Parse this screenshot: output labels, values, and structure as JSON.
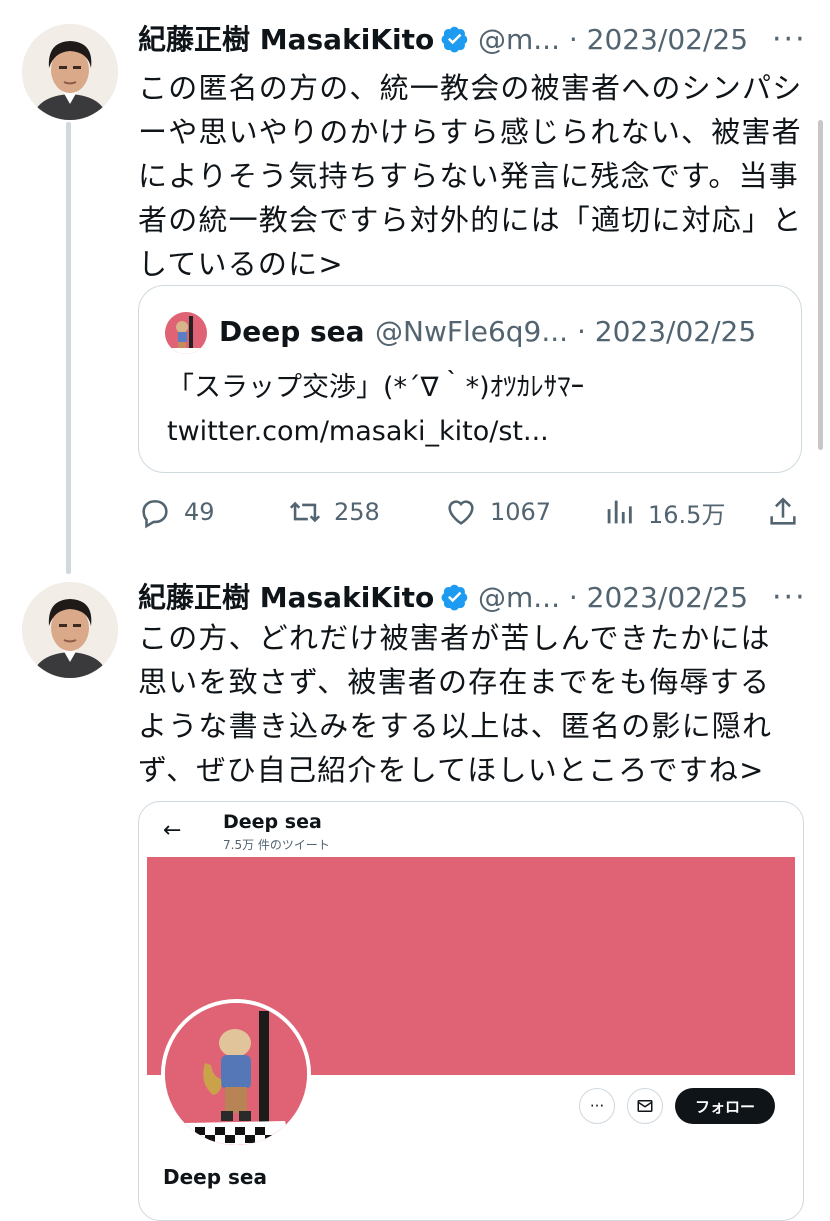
{
  "tweets": [
    {
      "author_name": "紀藤正樹 MasakiKito",
      "handle_date": "@m... · 2023/02/25",
      "more": "···",
      "lines": [
        "この匿名の方の、統一教会の被害者へのシンパシ",
        "ーや思いやりのかけらすら感じられない、被害者",
        "によりそう気持ちすらない発言に残念です。当事",
        "者の統一教会ですら対外的には「適切に対応」と",
        "しているのに>"
      ],
      "quote": {
        "name": "Deep sea",
        "handle_date": "@NwFle6q9... · 2023/02/25",
        "line1": "「スラップ交渉」(*´∇｀*)ｵﾂｶﾚｻﾏｰ",
        "line2": "twitter.com/masaki_kito/st..."
      },
      "actions": {
        "replies": "49",
        "retweets": "258",
        "likes": "1067",
        "views": "16.5万"
      }
    },
    {
      "author_name": "紀藤正樹 MasakiKito",
      "handle_date": "@m... · 2023/02/25",
      "more": "···",
      "lines": [
        "この方、どれだけ被害者が苦しんできたかには",
        "思いを致さず、被害者の存在までをも侮辱する",
        "ような書き込みをする以上は、匿名の影に隠れ",
        "ず、ぜひ自己紹介をしてほしいところですね>"
      ],
      "embed": {
        "back": "←",
        "title": "Deep sea",
        "subtitle": "7.5万 件のツイート",
        "follow": "フォロー",
        "more": "···",
        "profile_name": "Deep sea"
      }
    }
  ],
  "colors": {
    "verified": "#1d9bf0",
    "banner": "#df6374",
    "muted": "#536471",
    "border": "#cfd9de"
  }
}
